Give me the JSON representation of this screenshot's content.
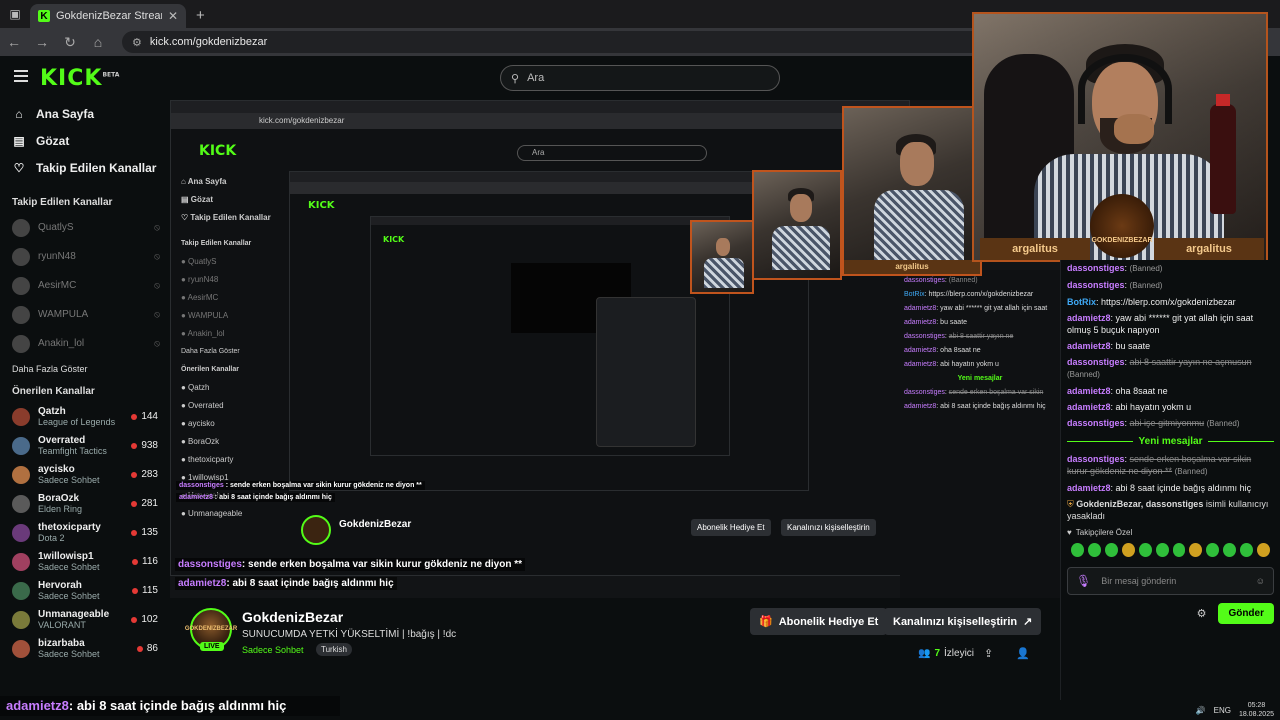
{
  "browser": {
    "tab_title": "GokdenizBezar Stream - Watch",
    "url": "kick.com/gokdenizbezar"
  },
  "kick": {
    "logo": "KICK",
    "logo_badge": "BETA",
    "search_placeholder": "Ara"
  },
  "sidebar": {
    "nav": [
      {
        "label": "Ana Sayfa",
        "icon": "home-icon"
      },
      {
        "label": "Gözat",
        "icon": "browse-icon"
      },
      {
        "label": "Takip Edilen Kanallar",
        "icon": "heart-icon"
      }
    ],
    "followed_header": "Takip Edilen Kanallar",
    "followed": [
      {
        "name": "QuatlyS"
      },
      {
        "name": "ryunN48"
      },
      {
        "name": "AesirMC"
      },
      {
        "name": "WAMPULA"
      },
      {
        "name": "Anakin_lol"
      }
    ],
    "followed_more": "Daha Fazla Göster",
    "recommended_header": "Önerilen Kanallar",
    "recommended": [
      {
        "name": "Qatzh",
        "category": "League of Legends",
        "viewers": "144"
      },
      {
        "name": "Overrated",
        "category": "Teamfight Tactics",
        "viewers": "938"
      },
      {
        "name": "aycisko",
        "category": "Sadece Sohbet",
        "viewers": "283"
      },
      {
        "name": "BoraOzk",
        "category": "Elden Ring",
        "viewers": "281"
      },
      {
        "name": "thetoxicparty",
        "category": "Dota 2",
        "viewers": "135"
      },
      {
        "name": "1willowisp1",
        "category": "Sadece Sohbet",
        "viewers": "116"
      },
      {
        "name": "Hervorah",
        "category": "Sadece Sohbet",
        "viewers": "115"
      },
      {
        "name": "Unmanageable",
        "category": "VALORANT",
        "viewers": "102"
      },
      {
        "name": "bizarbaba",
        "category": "Sadece Sohbet",
        "viewers": "86"
      }
    ]
  },
  "stream_overlay": {
    "nested_search": "Ara",
    "nested_url": "kick.com/gokdenizbezar",
    "line1_user": "dassonstiges",
    "line1_text": ": sende erken boşalma var sikin kurur gökdeniz ne diyon **",
    "line2_user": "adamietz8",
    "line2_text": ": abi 8 saat içinde bağış aldınmı hiç",
    "cam_label": "argalitus"
  },
  "channel": {
    "name": "GokdenizBezar",
    "title": "SUNUCUMDA YETKİ YÜKSELTİMİ | !bağış | !dc",
    "category": "Sadece Sohbet",
    "tag": "Turkish",
    "live": "LIVE",
    "avatar_text": "GOKDENIZBEZAR",
    "gift_button": "Abonelik Hediye Et",
    "customize_button": "Kanalınızı kişiselleştirin",
    "viewers_count": "7",
    "viewers_label": "İzleyici"
  },
  "webcam": {
    "label_left": "argalitus",
    "label_right": "argalitus",
    "badge": "GOKDENIZBEZAR"
  },
  "chat": {
    "messages": [
      {
        "user": "dassonstiges",
        "color": "#c77dff",
        "text": "",
        "deleted": "",
        "banned": "(Banned)"
      },
      {
        "user": "dassonstiges",
        "color": "#c77dff",
        "text": "",
        "deleted": "",
        "banned": "(Banned)"
      },
      {
        "user": "BotRix",
        "color": "#3fa9f5",
        "text": "https://blerp.com/x/gokdenizbezar",
        "deleted": "",
        "banned": ""
      },
      {
        "user": "adamietz8",
        "color": "#c77dff",
        "text": "yaw abi ****** git yat allah için saat olmuş 5 buçuk napıyon",
        "deleted": "",
        "banned": ""
      },
      {
        "user": "adamietz8",
        "color": "#c77dff",
        "text": "bu saate",
        "deleted": "",
        "banned": ""
      },
      {
        "user": "dassonstiges",
        "color": "#c77dff",
        "text": "",
        "deleted": "abi 8 saattir yayın ne açmusun",
        "banned": "(Banned)"
      },
      {
        "user": "adamietz8",
        "color": "#c77dff",
        "text": "oha 8saat ne",
        "deleted": "",
        "banned": ""
      },
      {
        "user": "adamietz8",
        "color": "#c77dff",
        "text": "abi hayatın yokm u",
        "deleted": "",
        "banned": ""
      },
      {
        "user": "dassonstiges",
        "color": "#c77dff",
        "text": "",
        "deleted": "abi işe gitmiyonmu",
        "banned": "(Banned)"
      }
    ],
    "new_messages": "Yeni mesajlar",
    "after_divider": [
      {
        "user": "dassonstiges",
        "color": "#c77dff",
        "text": "",
        "deleted": "sende erken boşalma var sikin kurur gökdeniz ne diyon **",
        "banned": "(Banned)"
      },
      {
        "user": "adamietz8",
        "color": "#c77dff",
        "text": "abi 8 saat içinde bağış aldınmı hiç",
        "deleted": "",
        "banned": ""
      }
    ],
    "system_notice_users": "GokdenizBezar, dassonstiges",
    "system_notice_text": "isimli kullanıcıyı yasakladı",
    "follower_only": "Takipçilere Özel",
    "input_placeholder": "Bir mesaj gönderin",
    "send_label": "Gönder"
  },
  "caption": {
    "user": "adamietz8",
    "text": ": abi 8 saat içinde bağış aldınmı hiç"
  },
  "taskbar": {
    "lang": "ENG",
    "time": "05:28",
    "date": "18.08.2025"
  }
}
